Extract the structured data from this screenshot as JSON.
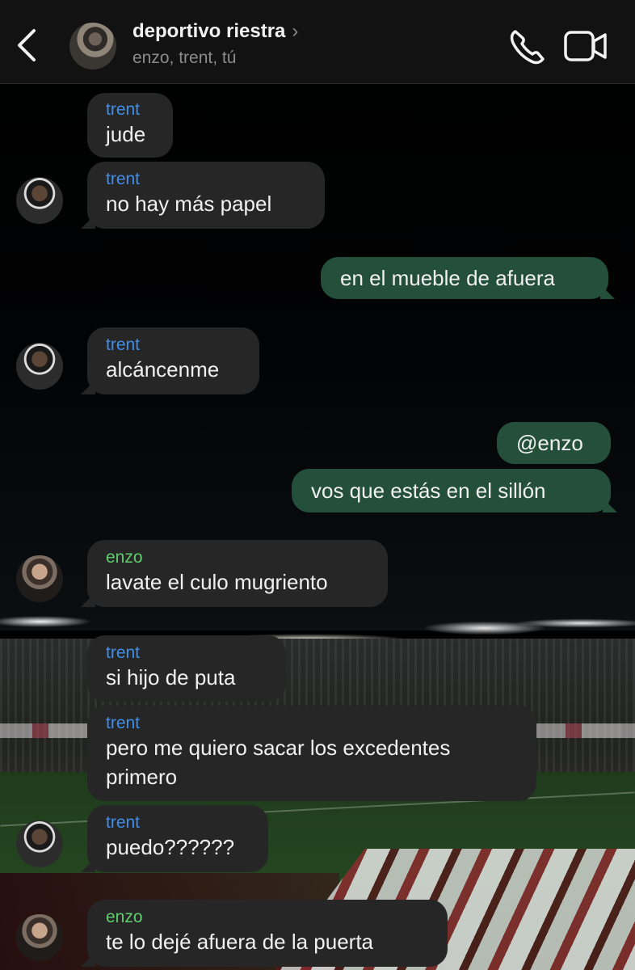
{
  "header": {
    "group_name": "deportivo riestra",
    "chevron": "›",
    "members": "enzo, trent, tú",
    "icons": [
      "back-arrow-icon",
      "phone-icon",
      "video-call-icon"
    ]
  },
  "colors": {
    "incoming_bubble": "#262626",
    "outgoing_bubble": "#244f3b",
    "trent_name": "#3f8ee9",
    "enzo_name": "#5fcd6c"
  },
  "messages": [
    {
      "sender": "trent",
      "text": "jude"
    },
    {
      "sender": "trent",
      "text": "no hay más papel"
    },
    {
      "text": "en el mueble de afuera"
    },
    {
      "sender": "trent",
      "text": "alcáncenme"
    },
    {
      "text": "@enzo"
    },
    {
      "text": "vos que estás en el sillón"
    },
    {
      "sender": "enzo",
      "text": "lavate el culo mugriento"
    },
    {
      "sender": "trent",
      "text": "si hijo de puta"
    },
    {
      "sender": "trent",
      "text": "pero me quiero sacar los excedentes primero"
    },
    {
      "sender": "trent",
      "text": "puedo??????"
    },
    {
      "sender": "enzo",
      "text": "te lo dejé afuera de la puerta"
    }
  ]
}
